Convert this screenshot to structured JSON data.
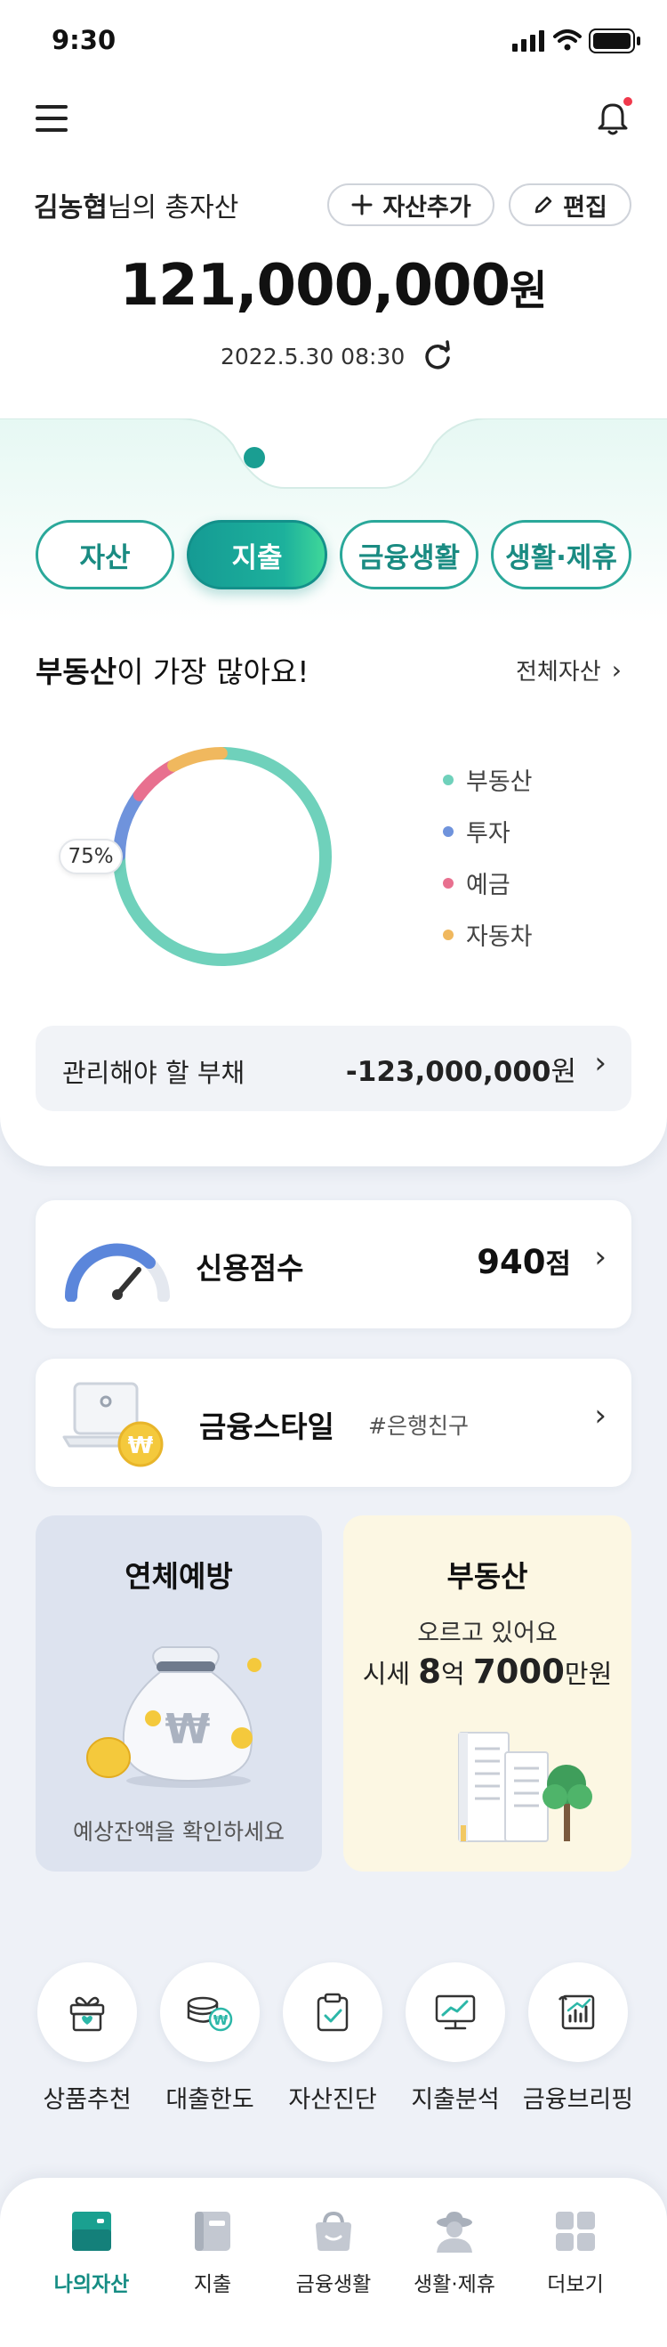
{
  "status_bar": {
    "time": "9:30"
  },
  "header": {
    "menu_icon": "hamburger-icon",
    "bell_icon": "bell-icon"
  },
  "assets": {
    "user_name": "김농협",
    "title_suffix": "님의 총자산",
    "add_label": "자산추가",
    "edit_label": "편집",
    "total_amount": "121,000,000",
    "currency": "원",
    "timestamp": "2022.5.30 08:30"
  },
  "tabs": [
    {
      "label": "자산",
      "active": false
    },
    {
      "label": "지출",
      "active": true
    },
    {
      "label": "금융생활",
      "active": false
    },
    {
      "label": "생활·제휴",
      "active": false
    }
  ],
  "summary": {
    "headline_bold": "부동산",
    "headline_rest": "이 가장 많아요!",
    "all_assets_link": "전체자산"
  },
  "chart_data": {
    "type": "pie",
    "donut": true,
    "categories": [
      "부동산",
      "투자",
      "예금",
      "자동차"
    ],
    "values": [
      75,
      10,
      7,
      8
    ],
    "colors": [
      "#6fd1bb",
      "#6f93dc",
      "#e8708f",
      "#f0b85e"
    ],
    "annotation": "75%"
  },
  "debt": {
    "label": "관리해야 할 부채",
    "amount": "-123,000,000",
    "currency": "원"
  },
  "credit": {
    "label": "신용점수",
    "score": "940",
    "unit": "점",
    "gauge_fraction": 0.75
  },
  "style": {
    "label": "금융스타일",
    "tag": "#은행친구"
  },
  "promo_overdue": {
    "title": "연체예방",
    "subtitle": "예상잔액을 확인하세요"
  },
  "promo_realestate": {
    "title": "부동산",
    "line1": "오르고 있어요",
    "price_prefix": "시세 ",
    "price_num1": "8",
    "price_unit1": "억 ",
    "price_num2": "7000",
    "price_unit2": "만원"
  },
  "quick_menu": [
    "상품추천",
    "대출한도",
    "자산진단",
    "지출분석",
    "금융브리핑"
  ],
  "bottom_nav": [
    {
      "label": "나의자산",
      "active": true
    },
    {
      "label": "지출",
      "active": false
    },
    {
      "label": "금융생활",
      "active": false
    },
    {
      "label": "생활·제휴",
      "active": false
    },
    {
      "label": "더보기",
      "active": false
    }
  ],
  "colors": {
    "accent": "#1a9e92",
    "mint": "#6fd1bb",
    "notification": "#f0394c"
  }
}
